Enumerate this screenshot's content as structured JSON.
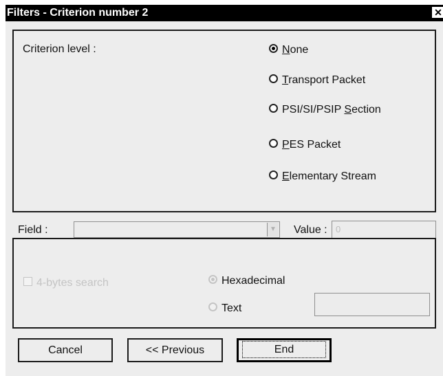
{
  "window": {
    "title": "Filters - Criterion number 2",
    "close_glyph": "✕"
  },
  "criterion": {
    "label": "Criterion level :",
    "options": [
      {
        "accel": "N",
        "rest": "one",
        "checked": true
      },
      {
        "accel": "T",
        "rest": "ransport Packet",
        "checked": false
      },
      {
        "prefix": "PSI/SI/PSIP ",
        "accel": "S",
        "rest": "ection",
        "checked": false
      },
      {
        "accel": "P",
        "rest": "ES Packet",
        "checked": false
      },
      {
        "accel": "E",
        "rest": "lementary Stream",
        "checked": false
      }
    ]
  },
  "field": {
    "label": "Field :",
    "value": "",
    "arrow_icon": "chevron-down-icon"
  },
  "value": {
    "label": "Value :",
    "text": "0"
  },
  "search": {
    "four_byte_label": "4-bytes search",
    "hex_label": "Hexadecimal",
    "text_label": "Text",
    "text_value": ""
  },
  "buttons": {
    "cancel": "Cancel",
    "previous": "<< Previous",
    "end": "End"
  }
}
